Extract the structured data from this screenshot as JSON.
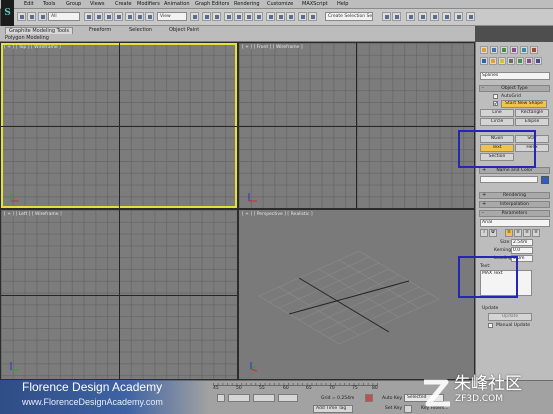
{
  "app": {
    "logo": "S"
  },
  "menu": [
    "Edit",
    "Tools",
    "Group",
    "Views",
    "Create",
    "Modifiers",
    "Animation",
    "Graph Editors",
    "Rendering",
    "Customize",
    "MAXScript",
    "Help"
  ],
  "toolbar": {
    "filter_select": "All",
    "coord_select": "View",
    "selection_set_placeholder": "Create Selection Se"
  },
  "ribbon": {
    "title": "Graphite Modeling Tools",
    "tabs": [
      "Freeform",
      "Selection",
      "Object Paint"
    ],
    "sub_label": "Polygon Modeling"
  },
  "viewports": {
    "top": "[ + ] [ Top ] [ Wireframe ]",
    "front": "[ + ] [ Front ] [ Wireframe ]",
    "left": "[ + ] [ Left ] [ Wireframe ]",
    "perspective": "[ + ] [ Perspective ] [ Realistic ]"
  },
  "command_panel": {
    "category_select": "Splines",
    "object_type": {
      "header": "Object Type",
      "autogrid": "AutoGrid",
      "start_new_shape": "Start New Shape",
      "buttons": [
        "Line",
        "Rectangle",
        "Circle",
        "Ellipse",
        "NGon",
        "Star",
        "Text",
        "Helix",
        "Section"
      ]
    },
    "name_color": {
      "header": "Name and Color"
    },
    "rendering": {
      "header": "Rendering"
    },
    "interpolation": {
      "header": "Interpolation"
    },
    "parameters": {
      "header": "Parameters",
      "font": "Arial",
      "size_label": "Size:",
      "size_value": "2.54m",
      "kerning_label": "Kerning:",
      "kerning_value": "0.0",
      "leading_label": "Leading:",
      "leading_value": "0.0m",
      "text_label": "Text:",
      "text_value": "MAX Text"
    },
    "update": {
      "header": "Update",
      "button": "Update",
      "manual": "Manual Update"
    }
  },
  "timeline": {
    "ticks": [
      "45",
      "50",
      "55",
      "60",
      "65",
      "70",
      "75",
      "80"
    ],
    "grid_readout": "Grid = 0.254m",
    "add_time_tag": "Add Time Tag",
    "auto_key": "Auto Key",
    "set_key": "Set Key",
    "selected_select": "Selected",
    "key_filters": "Key Filters..."
  },
  "watermark": {
    "title": "Florence Design Academy",
    "url": "www.FlorenceDesignAcademy.com",
    "cn_title": "朱峰社区",
    "domain": "ZF3D.COM"
  },
  "colors": {
    "active_viewport_border": "#e6e03a",
    "highlight_box": "#2525b8",
    "active_button": "#f0c34a"
  }
}
